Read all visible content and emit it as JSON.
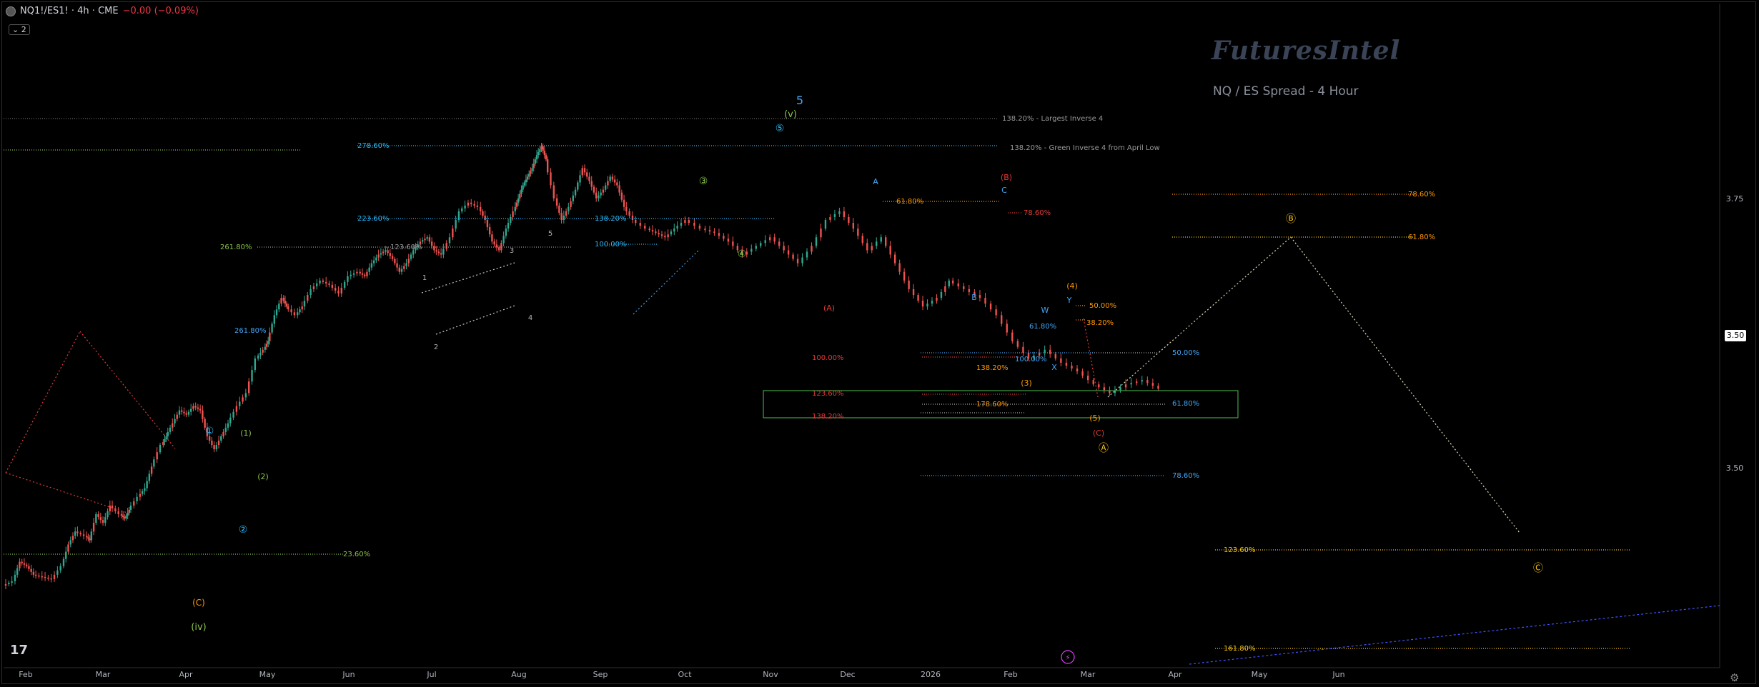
{
  "header": {
    "symbol": "NQ1!/ES1! · 4h · CME",
    "change": "−0.00 (−0.09%)",
    "collapse_label": "2"
  },
  "brand": "FuturesIntel",
  "subtitle": "NQ / ES Spread - 4 Hour",
  "colors": {
    "background": "#000000",
    "up": "#2fa88f",
    "down": "#ef5350",
    "cyan": "#29b6f6",
    "green": "#8bc34a",
    "orange": "#ff9800",
    "red": "#e53935",
    "yellow": "#f5c518",
    "blue": "#42a5f5",
    "gray": "#b0b0b0",
    "magenta": "#e040fb"
  },
  "chart_data": {
    "type": "line",
    "x_ticks": [
      "Feb",
      "Mar",
      "Apr",
      "May",
      "Jun",
      "Jul",
      "Aug",
      "Sep",
      "Oct",
      "Nov",
      "Dec",
      "2026",
      "Feb",
      "Mar",
      "Apr",
      "May",
      "Jun"
    ],
    "y_ticks": [
      "3.75",
      "3.50",
      "3.50"
    ],
    "current_price_label": "3.50",
    "x": [
      0,
      8,
      14,
      20,
      26,
      34,
      42,
      50,
      56,
      62,
      70,
      74,
      80,
      86,
      92,
      100,
      104,
      108,
      116,
      122,
      128,
      136,
      140,
      146,
      152,
      158,
      164,
      170,
      176,
      182,
      188,
      194,
      202,
      210,
      218,
      224,
      228,
      234,
      240,
      244,
      252,
      258,
      266,
      274,
      282,
      290,
      298,
      306,
      312,
      318,
      324,
      330,
      336,
      342,
      348,
      354,
      360,
      366,
      372,
      378,
      386,
      394,
      402,
      410,
      416,
      422,
      428,
      434,
      440,
      444,
      448,
      452,
      456,
      460,
      464,
      468,
      476,
      482,
      488,
      494,
      500,
      506,
      512,
      518,
      524,
      530,
      536,
      544,
      556,
      564,
      572,
      580,
      590,
      604,
      616,
      628,
      640,
      652,
      664,
      676,
      688,
      700,
      712,
      724,
      736,
      748,
      760,
      772,
      784,
      796,
      808,
      818,
      832,
      846,
      860,
      874,
      888,
      902,
      916,
      930,
      944,
      958,
      972,
      986,
      1000
    ],
    "y": [
      0.555,
      0.565,
      0.61,
      0.6,
      0.58,
      0.575,
      0.57,
      0.6,
      0.65,
      0.68,
      0.67,
      0.66,
      0.72,
      0.7,
      0.74,
      0.72,
      0.71,
      0.73,
      0.76,
      0.78,
      0.83,
      0.88,
      0.9,
      0.93,
      0.96,
      0.95,
      0.97,
      0.96,
      0.9,
      0.87,
      0.9,
      0.93,
      0.97,
      1.0,
      1.08,
      1.1,
      1.12,
      1.18,
      1.22,
      1.2,
      1.18,
      1.2,
      1.24,
      1.26,
      1.25,
      1.23,
      1.27,
      1.28,
      1.27,
      1.3,
      1.32,
      1.33,
      1.31,
      1.28,
      1.3,
      1.33,
      1.35,
      1.36,
      1.33,
      1.32,
      1.36,
      1.42,
      1.44,
      1.43,
      1.4,
      1.35,
      1.33,
      1.38,
      1.42,
      1.45,
      1.48,
      1.5,
      1.52,
      1.55,
      1.57,
      1.54,
      1.45,
      1.4,
      1.43,
      1.47,
      1.52,
      1.49,
      1.45,
      1.47,
      1.5,
      1.48,
      1.43,
      1.4,
      1.38,
      1.37,
      1.36,
      1.38,
      1.4,
      1.38,
      1.37,
      1.35,
      1.32,
      1.34,
      1.36,
      1.33,
      1.3,
      1.34,
      1.4,
      1.42,
      1.38,
      1.33,
      1.36,
      1.3,
      1.24,
      1.2,
      1.22,
      1.26,
      1.24,
      1.22,
      1.18,
      1.12,
      1.08,
      1.1,
      1.07,
      1.05,
      1.02,
      1.0,
      1.02,
      1.03,
      1.01
    ]
  },
  "annotations": {
    "wave_labels": [
      {
        "t": "5"
      },
      {
        "t": "(v)"
      },
      {
        "t": "⑤"
      },
      {
        "t": "(iv)"
      },
      {
        "t": "(C)"
      },
      {
        "t": "①"
      },
      {
        "t": "②"
      },
      {
        "t": "③"
      },
      {
        "t": "④"
      },
      {
        "t": "(1)"
      },
      {
        "t": "(2)"
      },
      {
        "t": "(3)"
      },
      {
        "t": "(4)"
      },
      {
        "t": "(5)"
      },
      {
        "t": "(A)"
      },
      {
        "t": "(B)"
      },
      {
        "t": "(C)"
      },
      {
        "t": "A"
      },
      {
        "t": "B"
      },
      {
        "t": "C"
      },
      {
        "t": "W"
      },
      {
        "t": "X"
      },
      {
        "t": "Y"
      },
      {
        "t": "Ⓐ"
      },
      {
        "t": "Ⓑ"
      },
      {
        "t": "Ⓒ"
      },
      {
        "t": "1"
      },
      {
        "t": "2"
      },
      {
        "t": "3"
      },
      {
        "t": "4"
      },
      {
        "t": "5"
      }
    ],
    "fib_labels": [
      {
        "t": "138.20% - Largest Inverse 4"
      },
      {
        "t": "138.20% - Green Inverse 4 from April Low"
      },
      {
        "t": "278.60%"
      },
      {
        "t": "223.60%"
      },
      {
        "t": "261.80%"
      },
      {
        "t": "261.80%"
      },
      {
        "t": "123.60%"
      },
      {
        "t": "138.20%"
      },
      {
        "t": "100.00%"
      },
      {
        "t": "23.60%"
      },
      {
        "t": "61.80%"
      },
      {
        "t": "78.60%"
      },
      {
        "t": "100.00%"
      },
      {
        "t": "138.20%"
      },
      {
        "t": "100.00%"
      },
      {
        "t": "123.60%"
      },
      {
        "t": "178.60%"
      },
      {
        "t": "138.20%"
      },
      {
        "t": "50.00%"
      },
      {
        "t": "38.20%"
      },
      {
        "t": "61.80%"
      },
      {
        "t": "50.00%"
      },
      {
        "t": "61.80%"
      },
      {
        "t": "78.60%"
      },
      {
        "t": "78.60%"
      },
      {
        "t": "61.80%"
      },
      {
        "t": "123.60%"
      },
      {
        "t": "161.80%"
      }
    ]
  }
}
